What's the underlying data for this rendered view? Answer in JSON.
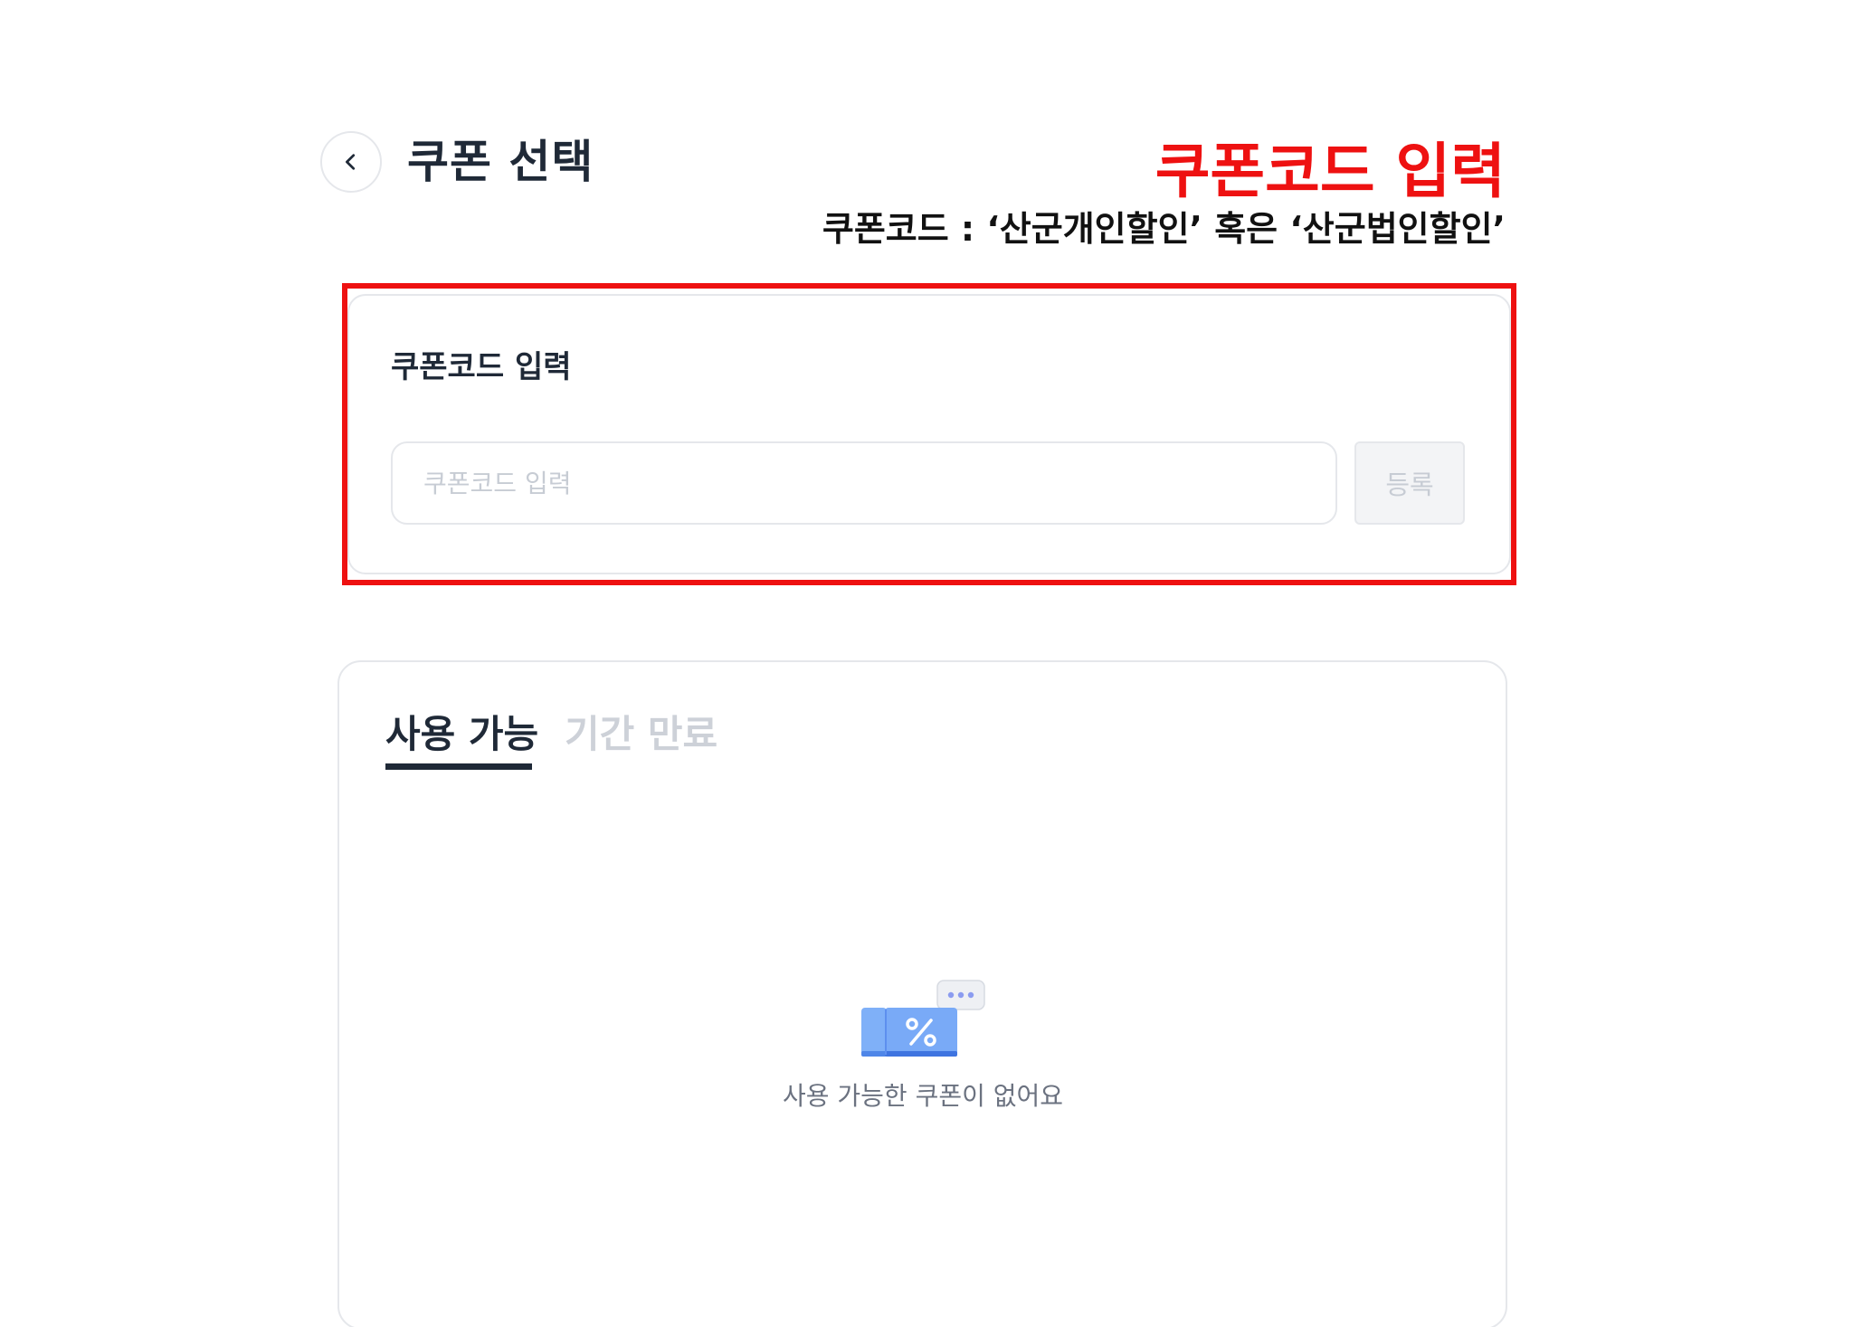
{
  "header": {
    "title": "쿠폰 선택",
    "back_icon": "chevron-left-icon"
  },
  "annotation": {
    "title": "쿠폰코드 입력",
    "subtitle": "쿠폰코드 : ‘산군개인할인’ 혹은 ‘산군법인할인’",
    "color": "#ee1111"
  },
  "coupon_code": {
    "label": "쿠폰코드 입력",
    "input_value": "",
    "input_placeholder": "쿠폰코드 입력",
    "register_label": "등록"
  },
  "coupon_list": {
    "tabs": [
      {
        "label": "사용 가능",
        "active": true
      },
      {
        "label": "기간 만료",
        "active": false
      }
    ],
    "empty_icon": "coupon-percent-icon",
    "empty_message": "사용 가능한 쿠폰이 없어요"
  }
}
